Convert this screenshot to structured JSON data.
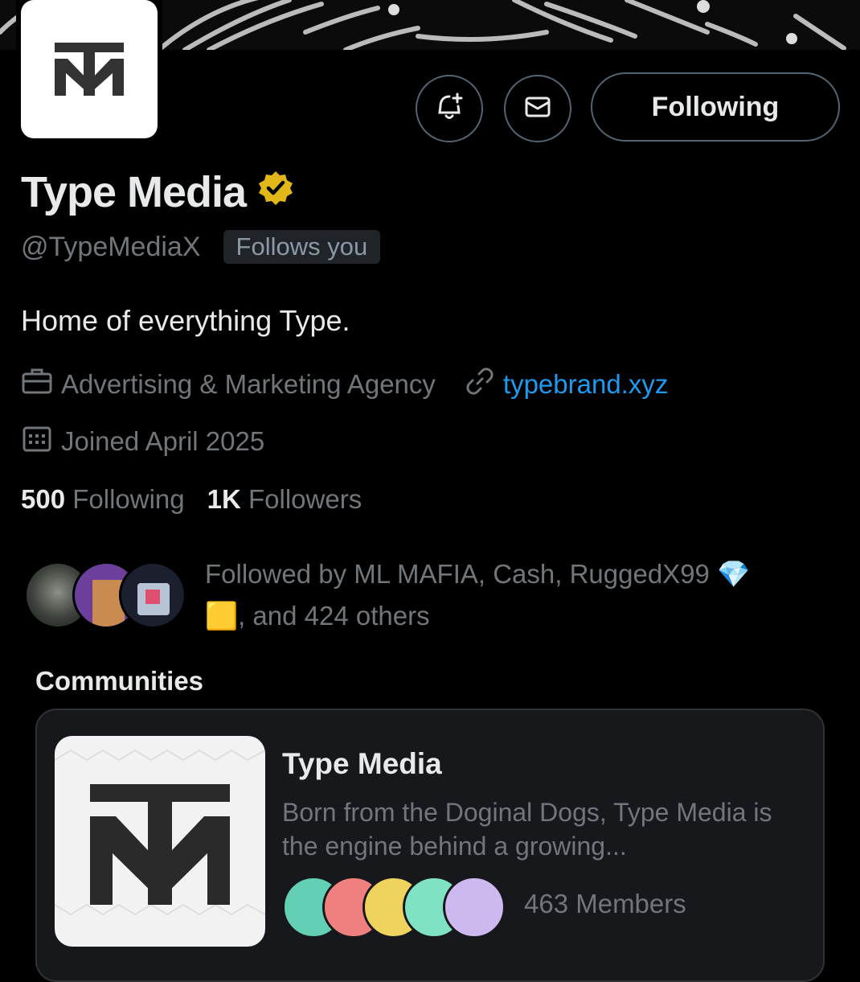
{
  "profile": {
    "name": "Type Media",
    "handle": "@TypeMediaX",
    "follows_you": "Follows you",
    "bio": "Home of everything Type.",
    "category": "Advertising & Marketing Agency",
    "website": "typebrand.xyz",
    "joined": "Joined April 2025",
    "following_count": "500",
    "following_label": "Following",
    "followers_count": "1K",
    "followers_label": "Followers",
    "verified_color": "#e2b719"
  },
  "actions": {
    "notify_icon": "bell-plus-icon",
    "message_icon": "envelope-icon",
    "follow_label": "Following"
  },
  "followed_by": {
    "line1": "Followed by ML MAFIA, Cash, RuggedX99 💎",
    "line2": "🟨, and 424 others"
  },
  "communities": {
    "title": "Communities",
    "card": {
      "name": "Type Media",
      "description": "Born from the Doginal Dogs, Type Media is the engine behind a growing...",
      "members": "463 Members"
    }
  }
}
